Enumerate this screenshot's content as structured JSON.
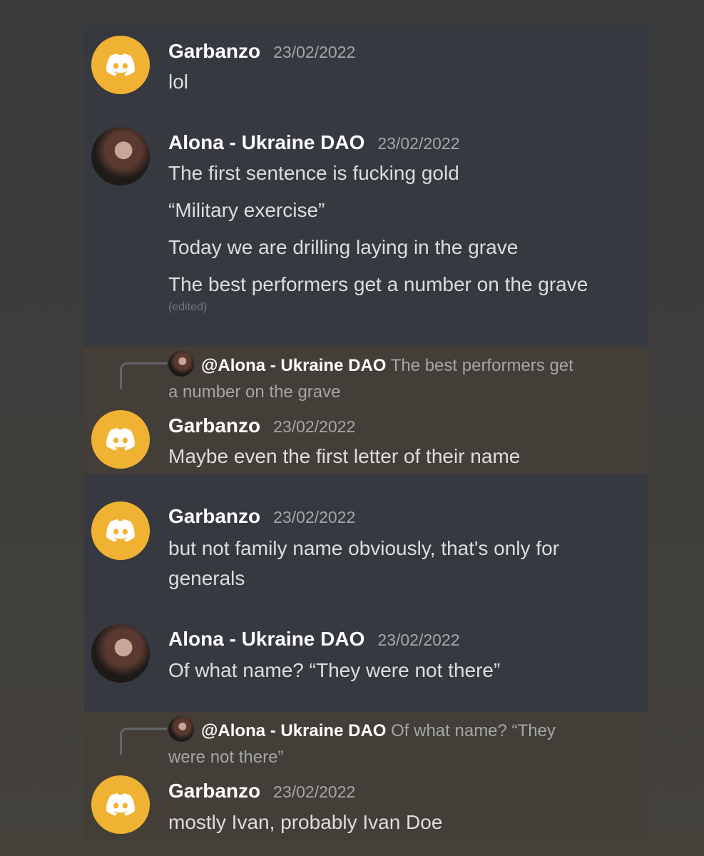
{
  "messages": [
    {
      "author": "Garbanzo",
      "timestamp": "23/02/2022",
      "lines": [
        "lol"
      ]
    },
    {
      "author": "Alona - Ukraine DAO",
      "timestamp": "23/02/2022",
      "lines": [
        "The first sentence is fucking gold",
        "“Military exercise”",
        "Today we are drilling laying in the grave",
        "The best performers get a number on the grave"
      ],
      "edited_label": "(edited)"
    },
    {
      "reply_to": {
        "mention": "@Alona - Ukraine DAO",
        "preview_line1": "The best performers get",
        "preview_line2": "a number on the grave"
      },
      "author": "Garbanzo",
      "timestamp": "23/02/2022",
      "lines": [
        "Maybe even the first letter of their name"
      ]
    },
    {
      "author": "Garbanzo",
      "timestamp": "23/02/2022",
      "lines": [
        "but not family name obviously, that's only for",
        "generals"
      ]
    },
    {
      "author": "Alona - Ukraine DAO",
      "timestamp": "23/02/2022",
      "lines": [
        "Of what name? “They were not there”"
      ]
    },
    {
      "reply_to": {
        "mention": "@Alona - Ukraine DAO",
        "preview_line1": "Of what name? “They",
        "preview_line2": "were not there”"
      },
      "author": "Garbanzo",
      "timestamp": "23/02/2022",
      "lines": [
        "mostly Ivan, probably Ivan Doe"
      ]
    }
  ],
  "colors": {
    "discord_avatar": "#f0b232",
    "chat_background": "#36393f",
    "reply_highlight": "#433e37"
  },
  "icons": {
    "discord_avatar": "discord-logo-icon"
  }
}
